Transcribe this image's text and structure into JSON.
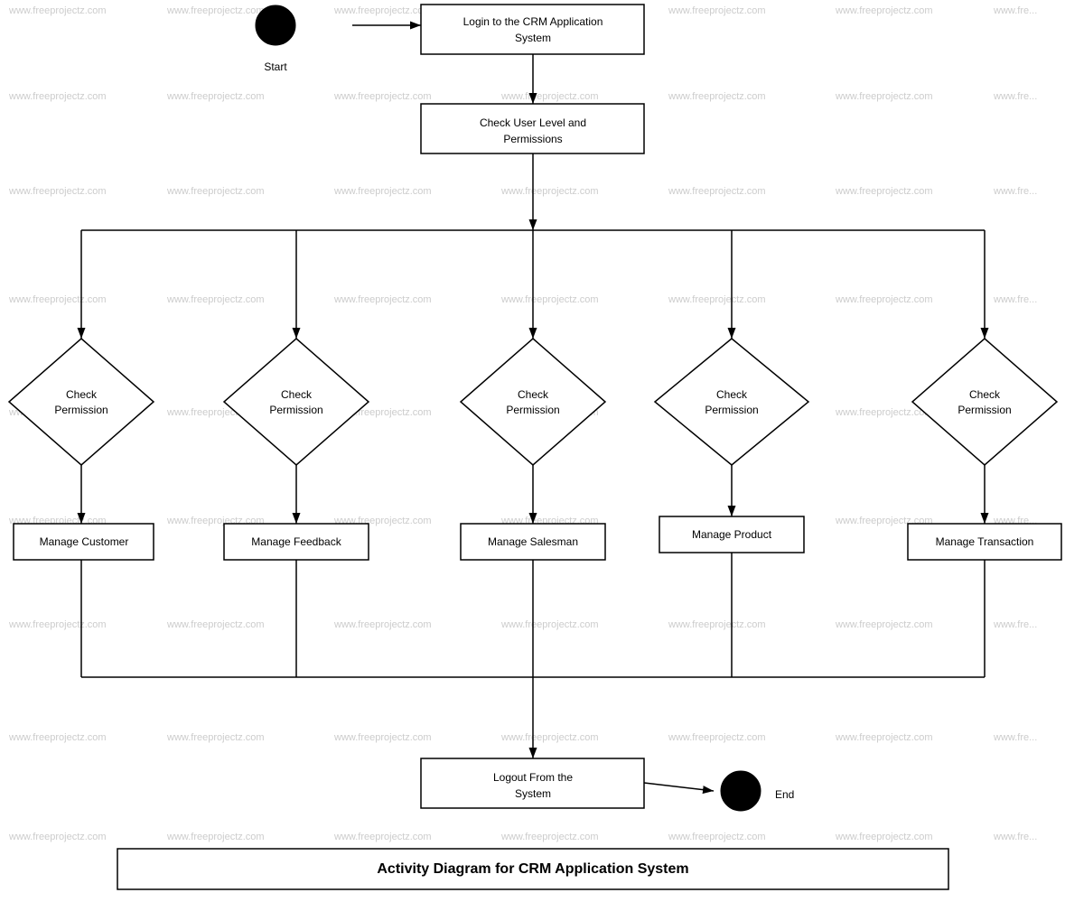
{
  "diagram": {
    "title": "Activity Diagram for CRM Application System",
    "nodes": {
      "start_label": "Start",
      "end_label": "End",
      "login": "Login to the CRM Application System",
      "check_user": "Check User Level and Permissions",
      "check_perm1": "Check\nPermission",
      "check_perm2": "Check\nPermission",
      "check_perm3": "Check\nPermission",
      "check_perm4": "Check\nPermission",
      "check_perm5": "Check\nPermission",
      "manage_customer": "Manage Customer",
      "manage_feedback": "Manage Feedback",
      "manage_salesman": "Manage Salesman",
      "manage_product": "Manage Product",
      "manage_transaction": "Manage Transaction",
      "logout": "Logout From the System"
    },
    "watermark": "www.freeprojectz.com"
  }
}
